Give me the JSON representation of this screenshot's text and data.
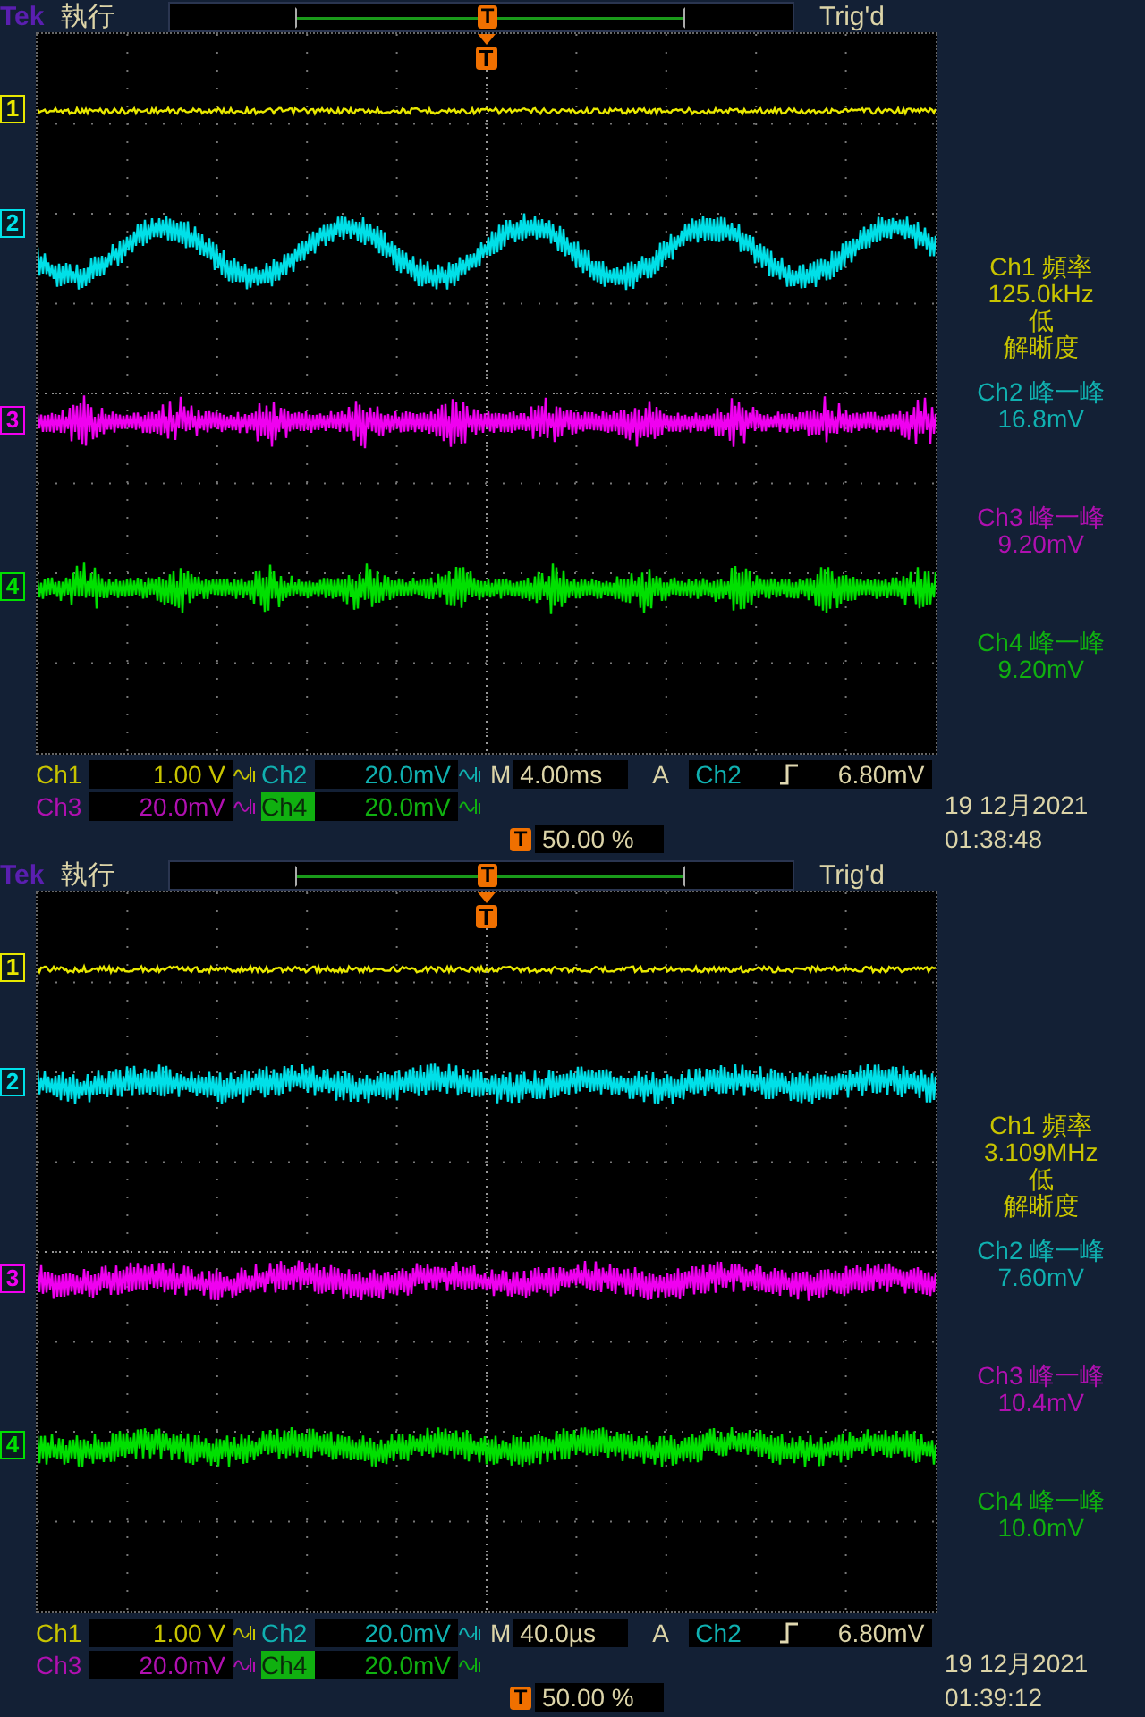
{
  "panels": [
    {
      "brand": "Tek",
      "run_state": "執行",
      "header_marker": "T",
      "trigger_status": "Trig'd",
      "screen_marker": "T",
      "traces": [
        {
          "marker": "1",
          "color": "#e8e800",
          "kind": "line"
        },
        {
          "marker": "2",
          "color": "#00e0e8",
          "kind": "sine"
        },
        {
          "marker": "3",
          "color": "#f000f0",
          "kind": "bursts"
        },
        {
          "marker": "4",
          "color": "#00e000",
          "kind": "bursts"
        }
      ],
      "measurements": [
        {
          "label": "Ch1 頻率",
          "value": "125.0kHz",
          "notes": [
            "低",
            "解晰度"
          ],
          "color": "#c8c400"
        },
        {
          "label": "Ch2 峰一峰",
          "value": "16.8mV",
          "color": "#10b0b0"
        },
        {
          "label": "Ch3 峰一峰",
          "value": "9.20mV",
          "color": "#b010b0"
        },
        {
          "label": "Ch4 峰一峰",
          "value": "9.20mV",
          "color": "#10b010"
        }
      ],
      "channel_settings": [
        {
          "label": "Ch1",
          "scale": "1.00 V",
          "color": "#c8c400",
          "selected": false,
          "bw_limit": true
        },
        {
          "label": "Ch2",
          "scale": "20.0mV",
          "color": "#10b0b0",
          "selected": false,
          "bw_limit": true
        },
        {
          "label": "Ch3",
          "scale": "20.0mV",
          "color": "#b010b0",
          "selected": false,
          "bw_limit": true
        },
        {
          "label": "Ch4",
          "scale": "20.0mV",
          "color": "#10b010",
          "selected": true,
          "bw_limit": true
        }
      ],
      "timebase": {
        "label": "M",
        "value": "4.00ms"
      },
      "trigger": {
        "mode": "A",
        "source": "Ch2",
        "level": "6.80mV"
      },
      "trigger_position": {
        "marker": "T",
        "value": "50.00 %"
      },
      "date": "19 12月2021",
      "time": "01:38:48"
    },
    {
      "brand": "Tek",
      "run_state": "執行",
      "header_marker": "T",
      "trigger_status": "Trig'd",
      "screen_marker": "T",
      "traces": [
        {
          "marker": "1",
          "color": "#e8e800",
          "kind": "line"
        },
        {
          "marker": "2",
          "color": "#00e0e8",
          "kind": "noise"
        },
        {
          "marker": "3",
          "color": "#f000f0",
          "kind": "noise"
        },
        {
          "marker": "4",
          "color": "#00e000",
          "kind": "noise"
        }
      ],
      "measurements": [
        {
          "label": "Ch1 頻率",
          "value": "3.109MHz",
          "notes": [
            "低",
            "解晰度"
          ],
          "color": "#c8c400"
        },
        {
          "label": "Ch2 峰一峰",
          "value": "7.60mV",
          "color": "#10b0b0"
        },
        {
          "label": "Ch3 峰一峰",
          "value": "10.4mV",
          "color": "#b010b0"
        },
        {
          "label": "Ch4 峰一峰",
          "value": "10.0mV",
          "color": "#10b010"
        }
      ],
      "channel_settings": [
        {
          "label": "Ch1",
          "scale": "1.00 V",
          "color": "#c8c400",
          "selected": false,
          "bw_limit": true
        },
        {
          "label": "Ch2",
          "scale": "20.0mV",
          "color": "#10b0b0",
          "selected": false,
          "bw_limit": true
        },
        {
          "label": "Ch3",
          "scale": "20.0mV",
          "color": "#b010b0",
          "selected": false,
          "bw_limit": true
        },
        {
          "label": "Ch4",
          "scale": "20.0mV",
          "color": "#10b010",
          "selected": true,
          "bw_limit": true
        }
      ],
      "timebase": {
        "label": "M",
        "value": "40.0µs"
      },
      "trigger": {
        "mode": "A",
        "source": "Ch2",
        "level": "6.80mV"
      },
      "trigger_position": {
        "marker": "T",
        "value": "50.00 %"
      },
      "date": "19 12月2021",
      "time": "01:39:12"
    }
  ]
}
